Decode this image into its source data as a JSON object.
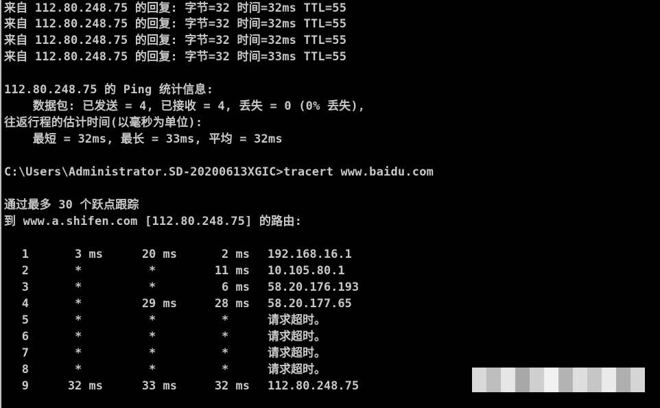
{
  "reply_lines": [
    "来自 112.80.248.75 的回复: 字节=32 时间=32ms TTL=55",
    "来自 112.80.248.75 的回复: 字节=32 时间=32ms TTL=55",
    "来自 112.80.248.75 的回复: 字节=32 时间=32ms TTL=55",
    "来自 112.80.248.75 的回复: 字节=32 时间=33ms TTL=55"
  ],
  "stats": {
    "header": "112.80.248.75 的 Ping 统计信息:",
    "packets": "    数据包: 已发送 = 4, 已接收 = 4, 丢失 = 0 (0% 丢失),",
    "rtt_header": "往返行程的估计时间(以毫秒为单位):",
    "rtt": "    最短 = 32ms, 最长 = 33ms, 平均 = 32ms"
  },
  "prompt": "C:\\Users\\Administrator.SD-20200613XGIC>tracert www.baidu.com",
  "tracert": {
    "header1": "通过最多 30 个跃点跟踪",
    "header2": "到 www.a.shifen.com [112.80.248.75] 的路由:",
    "hops": [
      {
        "num": "1",
        "t1": "3 ms",
        "t2": "20 ms",
        "t3": "2 ms",
        "host": "192.168.16.1"
      },
      {
        "num": "2",
        "t1": "*   ",
        "t2": "*   ",
        "t3": "11 ms",
        "host": "10.105.80.1"
      },
      {
        "num": "3",
        "t1": "*   ",
        "t2": "*   ",
        "t3": "6 ms",
        "host": "58.20.176.193"
      },
      {
        "num": "4",
        "t1": "*   ",
        "t2": "29 ms",
        "t3": "28 ms",
        "host": "58.20.177.65"
      },
      {
        "num": "5",
        "t1": "*   ",
        "t2": "*   ",
        "t3": "*   ",
        "host": "请求超时。"
      },
      {
        "num": "6",
        "t1": "*   ",
        "t2": "*   ",
        "t3": "*   ",
        "host": "请求超时。"
      },
      {
        "num": "7",
        "t1": "*   ",
        "t2": "*   ",
        "t3": "*   ",
        "host": "请求超时。"
      },
      {
        "num": "8",
        "t1": "*   ",
        "t2": "*   ",
        "t3": "*   ",
        "host": "请求超时。"
      },
      {
        "num": "9",
        "t1": "32 ms",
        "t2": "33 ms",
        "t3": "32 ms",
        "host": "112.80.248.75"
      }
    ]
  },
  "colors": {
    "background": "#000000",
    "text": "#c8c8c8"
  }
}
